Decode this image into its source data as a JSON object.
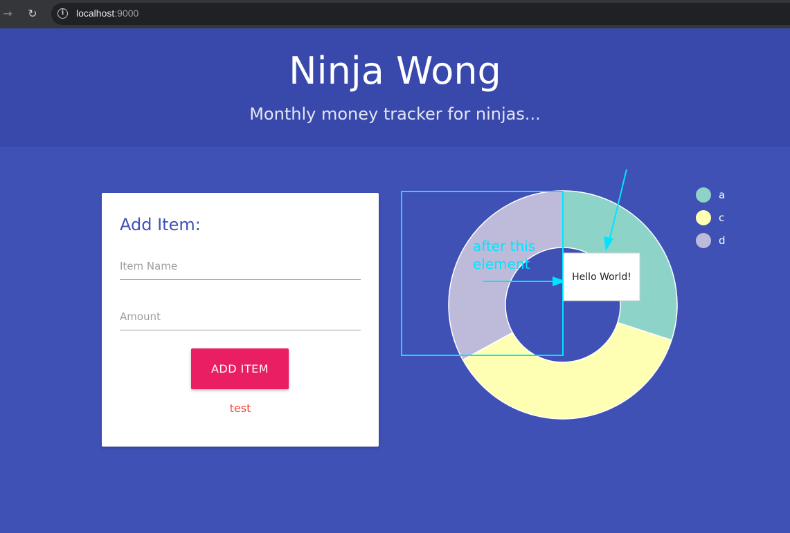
{
  "browser": {
    "url_host": "localhost",
    "url_port": ":9000"
  },
  "header": {
    "title": "Ninja Wong",
    "subtitle": "Monthly money tracker for ninjas..."
  },
  "form": {
    "title": "Add Item:",
    "name_placeholder": "Item Name",
    "amount_placeholder": "Amount",
    "button_label": "ADD ITEM",
    "error_text": "test"
  },
  "chart_data": {
    "type": "pie",
    "donut": true,
    "categories": [
      "a",
      "c",
      "d"
    ],
    "values": [
      30,
      37,
      33
    ],
    "colors": [
      "#8dd3c7",
      "#ffffb3",
      "#bebada"
    ],
    "legend_position": "top-right"
  },
  "annotation": {
    "label_line1": "after this",
    "label_line2": "element",
    "tooltip": "Hello World!",
    "color": "#00e5ff"
  }
}
